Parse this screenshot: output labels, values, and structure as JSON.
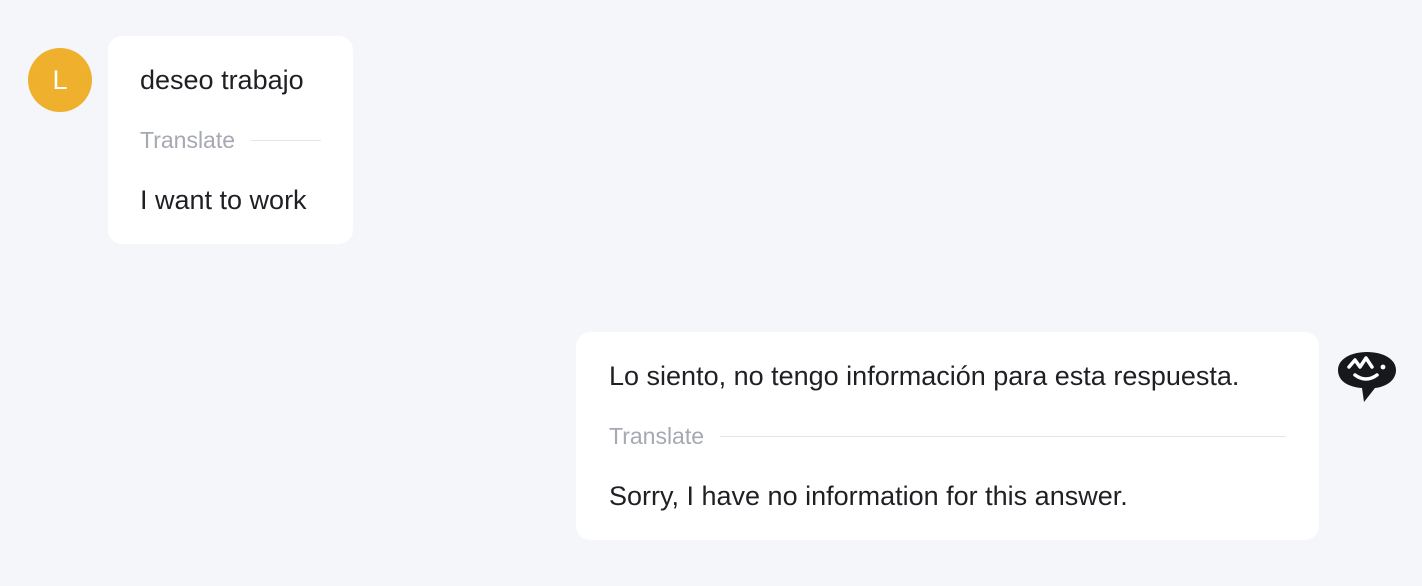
{
  "user_message": {
    "avatar_initial": "L",
    "avatar_color": "#efb02d",
    "original_text": "deseo trabajo",
    "translate_label": "Translate",
    "translated_text": "I want to work"
  },
  "bot_message": {
    "icon": "bot-face-icon",
    "original_text": "Lo siento, no tengo información para esta respuesta.",
    "translate_label": "Translate",
    "translated_text": "Sorry, I have no information for this answer."
  }
}
